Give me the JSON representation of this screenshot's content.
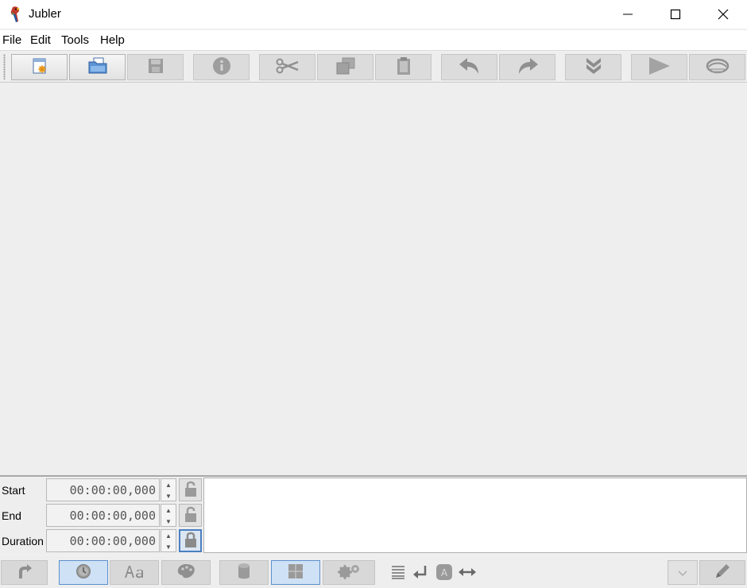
{
  "window": {
    "title": "Jubler",
    "minimize_glyph": "—",
    "maximize_glyph": "☐",
    "close_glyph": "✕"
  },
  "menu": {
    "items": [
      "File",
      "Edit",
      "Tools",
      "Help"
    ]
  },
  "toolbar": {
    "buttons": [
      {
        "name": "new-file",
        "icon": "new-document-icon",
        "enabled": true
      },
      {
        "name": "open-file",
        "icon": "open-folder-icon",
        "enabled": true
      },
      {
        "name": "save-file",
        "icon": "save-disk-icon",
        "enabled": false
      },
      {
        "name": "info",
        "icon": "info-icon",
        "enabled": false
      },
      {
        "name": "cut",
        "icon": "scissors-icon",
        "enabled": false
      },
      {
        "name": "copy",
        "icon": "copy-icon",
        "enabled": false
      },
      {
        "name": "paste",
        "icon": "paste-clipboard-icon",
        "enabled": false
      },
      {
        "name": "undo",
        "icon": "undo-arrow-icon",
        "enabled": false
      },
      {
        "name": "redo",
        "icon": "redo-arrow-icon",
        "enabled": false
      },
      {
        "name": "go-down",
        "icon": "double-chevron-down-icon",
        "enabled": false
      },
      {
        "name": "play",
        "icon": "play-icon",
        "enabled": false
      },
      {
        "name": "preview",
        "icon": "eye-icon",
        "enabled": false
      }
    ]
  },
  "edit_panel": {
    "start_label": "Start",
    "start_value": "00:00:00,000",
    "end_label": "End",
    "end_value": "00:00:00,000",
    "duration_label": "Duration",
    "duration_value": "00:00:00,000",
    "subtitle_text": ""
  },
  "bottom_toolbar": {
    "buttons": [
      {
        "name": "apply",
        "icon": "apply-arrow-icon",
        "selected": false
      },
      {
        "name": "time",
        "icon": "clock-icon",
        "selected": true
      },
      {
        "name": "font",
        "icon": "font-icon",
        "selected": false
      },
      {
        "name": "color",
        "icon": "palette-icon",
        "selected": false
      },
      {
        "name": "database",
        "icon": "cylinder-icon",
        "selected": false
      },
      {
        "name": "table-view",
        "icon": "grid-icon",
        "selected": true
      },
      {
        "name": "settings",
        "icon": "gears-icon",
        "selected": false
      },
      {
        "name": "align",
        "icon": "align-justify-icon",
        "selected": false
      },
      {
        "name": "newline",
        "icon": "return-arrow-icon",
        "selected": false
      },
      {
        "name": "style-mark",
        "icon": "letter-a-icon",
        "selected": false
      },
      {
        "name": "width",
        "icon": "horizontal-arrows-icon",
        "selected": false
      },
      {
        "name": "dropdown",
        "icon": "chevron-down-icon",
        "selected": false
      },
      {
        "name": "edit",
        "icon": "pencil-icon",
        "selected": false
      }
    ]
  },
  "colors": {
    "selected_border": "#5b8fcc",
    "window_bg": "#f0f0f0",
    "panel_bg": "#eeeeee"
  }
}
